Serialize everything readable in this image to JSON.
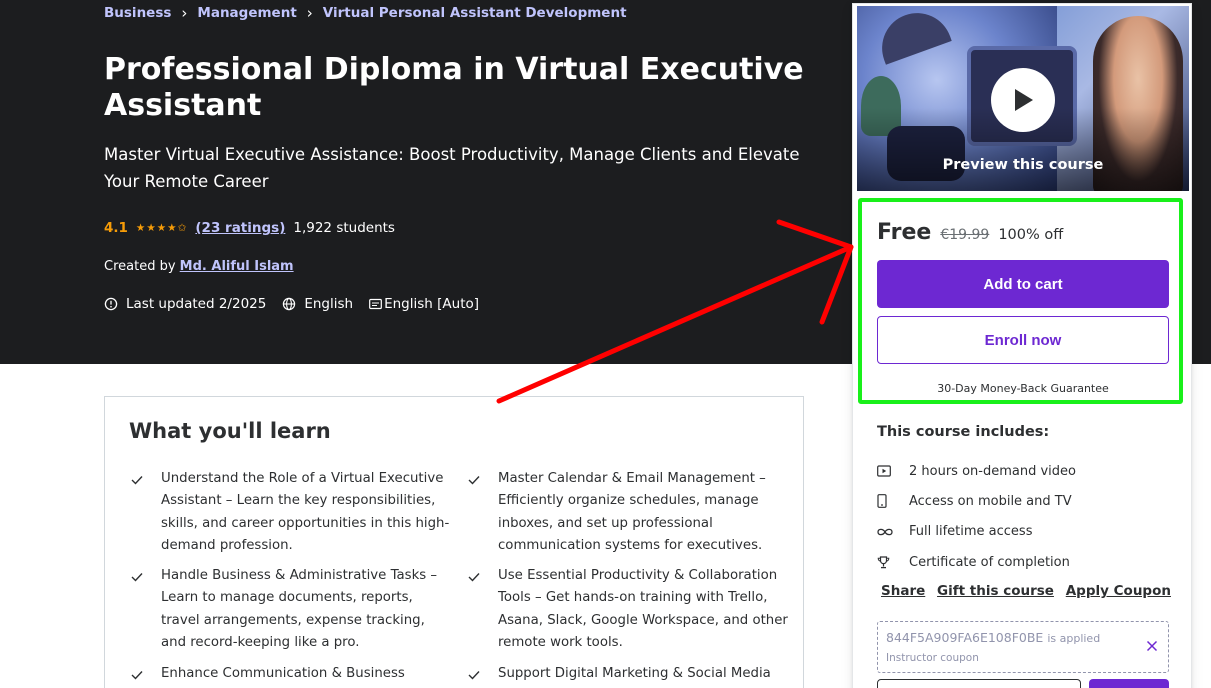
{
  "breadcrumb": {
    "items": [
      "Business",
      "Management",
      "Virtual Personal Assistant Development"
    ],
    "separator": "›"
  },
  "course": {
    "title": "Professional Diploma in Virtual Executive Assistant",
    "subtitle": "Master Virtual Executive Assistance: Boost Productivity, Manage Clients and Elevate Your Remote Career",
    "rating": "4.1",
    "stars": "★★★★✩",
    "ratings_count": "(23 ratings)",
    "students": "1,922 students",
    "created_by_label": "Created by",
    "instructor": "Md. Aliful Islam",
    "last_updated": "Last updated 2/2025",
    "language": "English",
    "captions": "English [Auto]"
  },
  "card": {
    "preview_label": "Preview this course",
    "price": "Free",
    "original_price": "€19.99",
    "discount": "100% off",
    "add_to_cart": "Add to cart",
    "enroll_now": "Enroll now",
    "guarantee": "30-Day Money-Back Guarantee",
    "includes_title": "This course includes:",
    "includes": [
      {
        "icon": "video-icon",
        "text": "2 hours on-demand video"
      },
      {
        "icon": "mobile-icon",
        "text": "Access on mobile and TV"
      },
      {
        "icon": "infinity-icon",
        "text": "Full lifetime access"
      },
      {
        "icon": "trophy-icon",
        "text": "Certificate of completion"
      }
    ],
    "links": {
      "share": "Share",
      "gift": "Gift this course",
      "coupon": "Apply Coupon"
    },
    "coupon": {
      "code": "844F5A909FA6E108F0BE",
      "applied": "is applied",
      "label": "Instructor coupon"
    }
  },
  "learn": {
    "title": "What you'll learn",
    "items": [
      "Understand the Role of a Virtual Executive Assistant – Learn the key responsibilities, skills, and career opportunities in this high-demand profession.",
      "Master Calendar & Email Management – Efficiently organize schedules, manage inboxes, and set up professional communication systems for executives.",
      "Handle Business & Administrative Tasks – Learn to manage documents, reports, travel arrangements, expense tracking, and record-keeping like a pro.",
      "Use Essential Productivity & Collaboration Tools – Get hands-on training with Trello, Asana, Slack, Google Workspace, and other remote work tools.",
      "Enhance Communication & Business",
      "Support Digital Marketing & Social Media"
    ]
  },
  "colors": {
    "hero_bg": "#1c1d1f",
    "link_purple": "#c0c4fc",
    "star_orange": "#f69c08",
    "brand_purple": "#6d28d2",
    "highlight_green": "#19f01a",
    "annotation_red": "#ff0000"
  }
}
